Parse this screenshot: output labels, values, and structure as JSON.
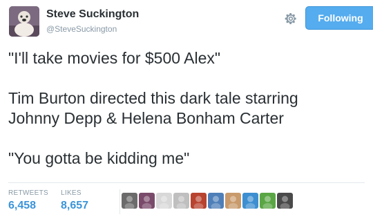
{
  "user": {
    "name": "Steve Suckington",
    "handle": "@SteveSuckington"
  },
  "follow_button": {
    "label": "Following",
    "color": "#55acee"
  },
  "tweet": {
    "lines": [
      "\"I'll take movies for $500 Alex\"",
      "Tim Burton directed this dark tale starring",
      "Johnny Depp & Helena Bonham Carter",
      "\"You gotta be kidding me\""
    ]
  },
  "stats": {
    "retweets_label": "RETWEETS",
    "retweets_value": "6,458",
    "likes_label": "LIKES",
    "likes_value": "8,657"
  },
  "likers": [
    {
      "color": "#6b6b6b"
    },
    {
      "color": "#7a4a6a"
    },
    {
      "color": "#d8d8d8"
    },
    {
      "color": "#bfbfbf"
    },
    {
      "color": "#b8432f"
    },
    {
      "color": "#4e7fb8"
    },
    {
      "color": "#c99a6b"
    },
    {
      "color": "#3e8fd1"
    },
    {
      "color": "#5aa645"
    },
    {
      "color": "#4a4a4a"
    }
  ]
}
